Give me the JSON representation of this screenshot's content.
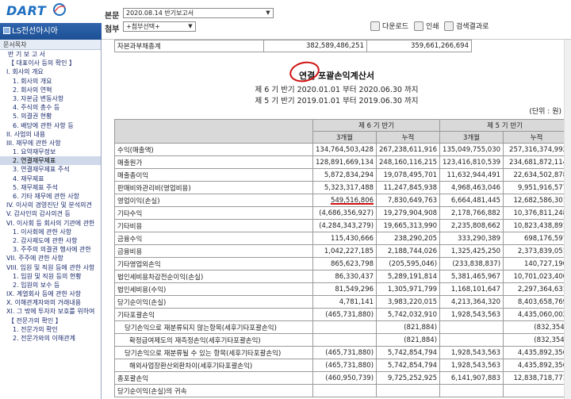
{
  "header": {
    "logo": "DART",
    "company": "LS전선아시아",
    "doc_label": "본문",
    "doc_select": "2020.08.14  반기보고서",
    "attach_label": "첨부",
    "attach_select": "+첨부선택+",
    "btn_download": "다운로드",
    "btn_print": "인쇄",
    "btn_search": "검색결과로"
  },
  "sidebar": {
    "title": "문서목차",
    "items": [
      "반 기 보 고 서",
      "【 대표이사 등의 확인 】",
      "I. 회사의 개요",
      "1. 회사의 개요",
      "2. 회사의 연혁",
      "3. 자본금 변동사항",
      "4. 주식의 총수 등",
      "5. 의결권 현황",
      "6. 배당에 관한 사항 등",
      "II. 사업의 내용",
      "III. 재무에 관한 사항",
      "1. 요약재무정보",
      "2. 연결재무제표",
      "3. 연결재무제표 주석",
      "4. 재무제표",
      "5. 재무제표 주석",
      "6. 기타 재무에 관한 사항",
      "IV. 이사의 경영진단 및 분석의견",
      "V. 감사인의 감사의견 등",
      "VI. 이사회 등 회사의 기관에 관한",
      "1. 이사회에 관한 사항",
      "2. 감사제도에 관한 사항",
      "3. 주주의 의결권 행사에 관한 ",
      "VII. 주주에 관한 사항",
      "VIII. 임원 및 직원 등에 관한 사항",
      "1. 임원 및 직원 등의 현황",
      "2. 임원의 보수 등",
      "IX. 계열회사 등에 관한 사항",
      "X. 이해관계자와의 거래내용",
      "XI. 그 밖에 투자자 보호를 위하여",
      "【 전문가의 확인 】",
      "1. 전문가의 확인",
      "2. 전문가와의 이해관계"
    ]
  },
  "prev_row": {
    "label": "자본과부채총계",
    "v1": "382,589,486,251",
    "v2": "359,661,266,694"
  },
  "statement": {
    "title": "연결 포괄손익계산서",
    "period1": "제 6 기 반기 2020.01.01 부터 2020.06.30 까지",
    "period2": "제 5 기 반기 2019.01.01 부터 2019.06.30 까지",
    "unit": "(단위 : 원)",
    "col_p1": "제 6 기 반기",
    "col_p2": "제 5 기 반기",
    "col_3m": "3개월",
    "col_cum": "누적",
    "rows": [
      [
        "수익(매출액)",
        "134,764,503,428",
        "267,238,611,916",
        "135,049,755,030",
        "257,316,374,992"
      ],
      [
        "매출원가",
        "128,891,669,134",
        "248,160,116,215",
        "123,416,810,539",
        "234,681,872,114"
      ],
      [
        "매출총이익",
        "5,872,834,294",
        "19,078,495,701",
        "11,632,944,491",
        "22,634,502,878"
      ],
      [
        "판매비와관리비(영업비용)",
        "5,323,317,488",
        "11,247,845,938",
        "4,968,463,046",
        "9,951,916,577"
      ],
      [
        "영업이익(손실)",
        "549,516,806",
        "7,830,649,763",
        "6,664,481,445",
        "12,682,586,301"
      ],
      [
        "기타수익",
        "(4,686,356,927)",
        "19,279,904,908",
        "2,178,766,882",
        "10,376,811,248"
      ],
      [
        "기타비용",
        "(4,284,343,279)",
        "19,665,313,990",
        "2,235,808,662",
        "10,823,438,891"
      ],
      [
        "금융수익",
        "115,430,666",
        "238,290,205",
        "333,290,389",
        "698,176,597"
      ],
      [
        "금융비용",
        "1,042,227,185",
        "2,188,744,026",
        "1,325,425,250",
        "2,373,839,051"
      ],
      [
        "기타영업외손익",
        "865,623,798",
        "(205,595,046)",
        "(233,838,837)",
        "140,727,196"
      ],
      [
        "법인세비용차감전순이익(손실)",
        "86,330,437",
        "5,289,191,814",
        "5,381,465,967",
        "10,701,023,400"
      ],
      [
        "법인세비용(수익)",
        "81,549,296",
        "1,305,971,799",
        "1,168,101,647",
        "2,297,364,631"
      ],
      [
        "당기순이익(손실)",
        "4,781,141",
        "3,983,220,015",
        "4,213,364,320",
        "8,403,658,769"
      ],
      [
        "기타포괄손익",
        "(465,731,880)",
        "5,742,032,910",
        "1,928,543,563",
        "4,435,060,002"
      ],
      [
        "당기손익으로 재분류되지 않는항목(세후기타포괄손익)",
        "",
        "(821,884)",
        "",
        "(832,354)"
      ],
      [
        "확정급여제도의 재측정손익(세후기타포괄손익)",
        "",
        "(821,884)",
        "",
        "(832,354)"
      ],
      [
        "당기손익으로 재분류될 수 있는 항목(세후기타포괄손익)",
        "(465,731,880)",
        "5,742,854,794",
        "1,928,543,563",
        "4,435,892,356"
      ],
      [
        "해외사업장환산외환차이(세후기타포괄손익)",
        "(465,731,880)",
        "5,742,854,794",
        "1,928,543,563",
        "4,435,892,356"
      ],
      [
        "총포괄손익",
        "(460,950,739)",
        "9,725,252,925",
        "6,141,907,883",
        "12,838,718,771"
      ],
      [
        "당기순이익(손실)의 귀속",
        "",
        "",
        "",
        ""
      ]
    ]
  }
}
